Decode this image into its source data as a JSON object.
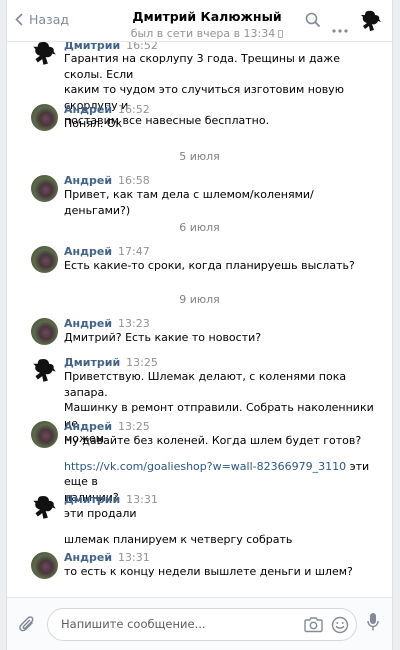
{
  "header": {
    "back_label": "Назад",
    "peer_name": "Дмитрий Калюжный",
    "peer_status": "был в сети вчера в 13:34"
  },
  "messages": [
    {
      "author": "Дмитрий",
      "time": "16:52",
      "lines": [
        "Гарантия на скорлупу 3 года. Трещины и даже сколы. Если",
        "каким то чудом это случиться изготовим новую скорлупу и",
        "поставим все навесные бесплатно."
      ]
    },
    {
      "author": "Андрей",
      "time": "16:52",
      "lines": [
        "Понял. Ок"
      ]
    },
    {
      "date": "5 июля"
    },
    {
      "author": "Андрей",
      "time": "16:58",
      "lines": [
        "Привет, как там дела с шлемом/коленями/деньгами?)"
      ]
    },
    {
      "date": "6 июля"
    },
    {
      "author": "Андрей",
      "time": "17:47",
      "lines": [
        "Есть какие-то сроки, когда планируешь выслать?"
      ]
    },
    {
      "date": "9 июля"
    },
    {
      "author": "Андрей",
      "time": "13:23",
      "lines": [
        "Дмитрий? Есть какие то новости?"
      ]
    },
    {
      "author": "Дмитрий",
      "time": "13:25",
      "lines": [
        "Приветствую. Шлемак делают, с коленями пока запара.",
        "Машинку в ремонт отправили. Собрать наколенники не",
        "можем"
      ]
    },
    {
      "author": "Андрей",
      "time": "13:25",
      "lines": [
        "Ну давайте без коленей. Когда шлем будет готов?"
      ],
      "link": "https://vk.com/goalieshop?w=wall-82366979_3110",
      "after_link": " эти еще в",
      "tail": "наличии?"
    },
    {
      "author": "Дмитрий",
      "time": "13:31",
      "lines": [
        "эти продали"
      ],
      "extra": "шлемак планируем к четвергу собрать"
    },
    {
      "author": "Андрей",
      "time": "13:31",
      "lines": [
        "то есть к концу недели вышлете деньги и шлем?"
      ]
    }
  ],
  "composer": {
    "placeholder": "Напишите сообщение..."
  },
  "icons": {
    "back": "chevron-left-icon",
    "search": "search-icon",
    "more": "more-icon",
    "attach": "paperclip-icon",
    "camera": "camera-icon",
    "emoji": "smile-icon",
    "mic": "microphone-icon"
  },
  "colors": {
    "link": "#2a5885",
    "author": "#42648b",
    "meta": "#939393"
  }
}
